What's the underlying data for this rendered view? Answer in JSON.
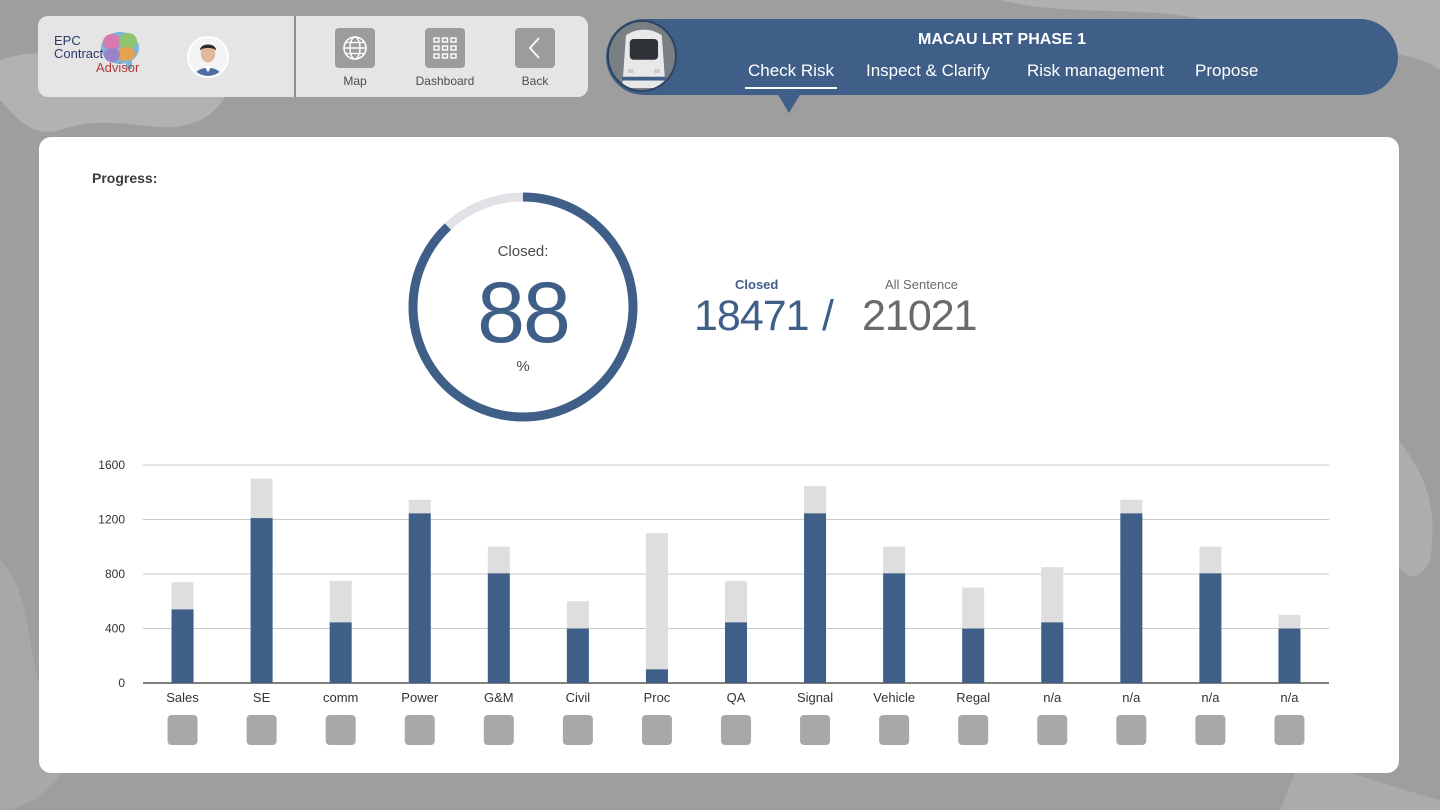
{
  "logo": {
    "line1": "EPC",
    "line2": "Contract",
    "line3": "Advisor"
  },
  "toolbar": [
    {
      "label": "Map",
      "icon": "globe-icon"
    },
    {
      "label": "Dashboard",
      "icon": "grid-icon"
    },
    {
      "label": "Back",
      "icon": "chevron-left-icon"
    }
  ],
  "project": {
    "title": "MACAU LRT PHASE 1",
    "tabs": [
      "Check Risk",
      "Inspect & Clarify",
      "Risk management",
      "Propose"
    ],
    "active_tab": "Check Risk"
  },
  "progress": {
    "label": "Progress:",
    "ring_caption": "Closed:",
    "percent": "88",
    "percent_unit": "%",
    "closed_label": "Closed",
    "closed_value": "18471",
    "slash": "/",
    "all_label": "All Sentence",
    "all_value": "21021"
  },
  "colors": {
    "accent": "#3f5f88",
    "bar_total": "#dedede",
    "grid": "#c8c8c8",
    "square": "#a7a9a9"
  },
  "chart_data": {
    "type": "bar",
    "categories": [
      "Sales",
      "SE",
      "comm",
      "Power",
      "G&M",
      "Civil",
      "Proc",
      "QA",
      "Signal",
      "Vehicle",
      "Regal",
      "n/a",
      "n/a",
      "n/a",
      "n/a"
    ],
    "series": [
      {
        "values": [
          540,
          1210,
          445,
          1245,
          805,
          400,
          100,
          445,
          1245,
          805,
          400,
          445,
          1245,
          805,
          400
        ]
      },
      {
        "values": [
          740,
          1500,
          750,
          1345,
          1000,
          600,
          1100,
          750,
          1445,
          1000,
          700,
          850,
          1345,
          1000,
          500
        ]
      }
    ],
    "yticks": [
      0,
      400,
      800,
      1200,
      1600
    ],
    "ylim": [
      0,
      1600
    ],
    "grid": true,
    "stacked": "overlap"
  }
}
